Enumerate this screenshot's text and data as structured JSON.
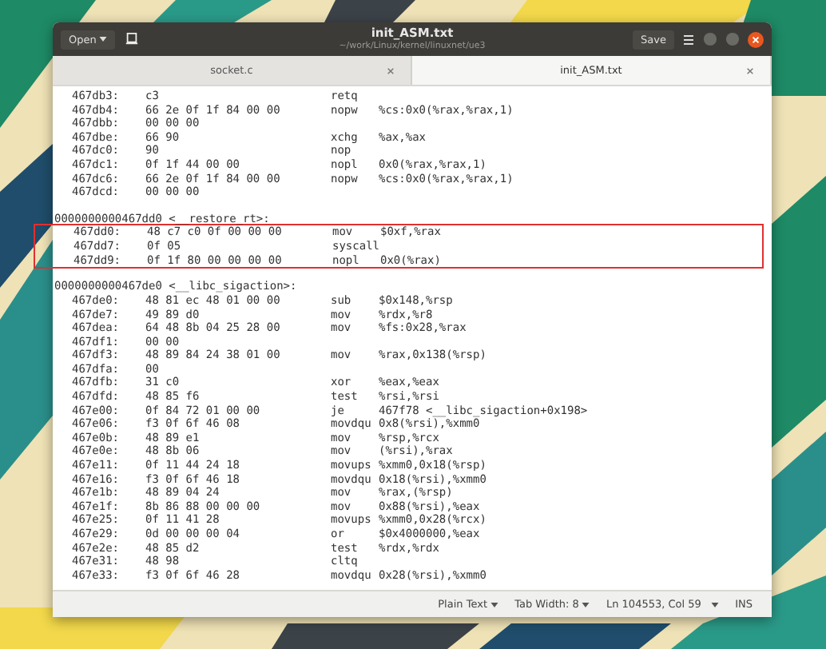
{
  "window": {
    "title": "init_ASM.txt",
    "subtitle": "~/work/Linux/kernel/linuxnet/ue3"
  },
  "header": {
    "open_button": "Open",
    "save_button": "Save"
  },
  "tabs": [
    {
      "label": "socket.c",
      "selected": false
    },
    {
      "label": "init_ASM.txt",
      "selected": true
    }
  ],
  "lines": [
    {
      "kind": "instr",
      "addr": "467db3:",
      "bytes": "c3",
      "mnemonic": "retq",
      "highlighted": false
    },
    {
      "kind": "instr",
      "addr": "467db4:",
      "bytes": "66 2e 0f 1f 84 00 00",
      "mnemonic": "nopw",
      "operands": "%cs:0x0(%rax,%rax,1)",
      "highlighted": false
    },
    {
      "kind": "instr",
      "addr": "467dbb:",
      "bytes": "00 00 00",
      "highlighted": false
    },
    {
      "kind": "instr",
      "addr": "467dbe:",
      "bytes": "66 90",
      "mnemonic": "xchg",
      "operands": "%ax,%ax",
      "highlighted": false
    },
    {
      "kind": "instr",
      "addr": "467dc0:",
      "bytes": "90",
      "mnemonic": "nop",
      "highlighted": false
    },
    {
      "kind": "instr",
      "addr": "467dc1:",
      "bytes": "0f 1f 44 00 00",
      "mnemonic": "nopl",
      "operands": "0x0(%rax,%rax,1)",
      "highlighted": false
    },
    {
      "kind": "instr",
      "addr": "467dc6:",
      "bytes": "66 2e 0f 1f 84 00 00",
      "mnemonic": "nopw",
      "operands": "%cs:0x0(%rax,%rax,1)",
      "highlighted": false
    },
    {
      "kind": "instr",
      "addr": "467dcd:",
      "bytes": "00 00 00",
      "highlighted": false
    },
    {
      "kind": "blank"
    },
    {
      "kind": "label",
      "text": "0000000000467dd0 <__restore_rt>:",
      "highlighted": false
    },
    {
      "kind": "instr",
      "addr": "467dd0:",
      "bytes": "48 c7 c0 0f 00 00 00",
      "mnemonic": "mov",
      "operands": "$0xf,%rax",
      "highlighted": true
    },
    {
      "kind": "instr",
      "addr": "467dd7:",
      "bytes": "0f 05",
      "mnemonic": "syscall",
      "highlighted": true
    },
    {
      "kind": "instr",
      "addr": "467dd9:",
      "bytes": "0f 1f 80 00 00 00 00",
      "mnemonic": "nopl",
      "operands": "0x0(%rax)",
      "highlighted": true
    },
    {
      "kind": "blank"
    },
    {
      "kind": "label",
      "text": "0000000000467de0 <__libc_sigaction>:",
      "highlighted": false
    },
    {
      "kind": "instr",
      "addr": "467de0:",
      "bytes": "48 81 ec 48 01 00 00",
      "mnemonic": "sub",
      "operands": "$0x148,%rsp",
      "highlighted": false
    },
    {
      "kind": "instr",
      "addr": "467de7:",
      "bytes": "49 89 d0",
      "mnemonic": "mov",
      "operands": "%rdx,%r8",
      "highlighted": false
    },
    {
      "kind": "instr",
      "addr": "467dea:",
      "bytes": "64 48 8b 04 25 28 00",
      "mnemonic": "mov",
      "operands": "%fs:0x28,%rax",
      "highlighted": false
    },
    {
      "kind": "instr",
      "addr": "467df1:",
      "bytes": "00 00",
      "highlighted": false
    },
    {
      "kind": "instr",
      "addr": "467df3:",
      "bytes": "48 89 84 24 38 01 00",
      "mnemonic": "mov",
      "operands": "%rax,0x138(%rsp)",
      "highlighted": false
    },
    {
      "kind": "instr",
      "addr": "467dfa:",
      "bytes": "00",
      "highlighted": false
    },
    {
      "kind": "instr",
      "addr": "467dfb:",
      "bytes": "31 c0",
      "mnemonic": "xor",
      "operands": "%eax,%eax",
      "highlighted": false
    },
    {
      "kind": "instr",
      "addr": "467dfd:",
      "bytes": "48 85 f6",
      "mnemonic": "test",
      "operands": "%rsi,%rsi",
      "highlighted": false
    },
    {
      "kind": "instr",
      "addr": "467e00:",
      "bytes": "0f 84 72 01 00 00",
      "mnemonic": "je",
      "operands": "467f78 <__libc_sigaction+0x198>",
      "highlighted": false
    },
    {
      "kind": "instr",
      "addr": "467e06:",
      "bytes": "f3 0f 6f 46 08",
      "mnemonic": "movdqu",
      "operands": "0x8(%rsi),%xmm0",
      "highlighted": false
    },
    {
      "kind": "instr",
      "addr": "467e0b:",
      "bytes": "48 89 e1",
      "mnemonic": "mov",
      "operands": "%rsp,%rcx",
      "highlighted": false
    },
    {
      "kind": "instr",
      "addr": "467e0e:",
      "bytes": "48 8b 06",
      "mnemonic": "mov",
      "operands": "(%rsi),%rax",
      "highlighted": false
    },
    {
      "kind": "instr",
      "addr": "467e11:",
      "bytes": "0f 11 44 24 18",
      "mnemonic": "movups",
      "operands": "%xmm0,0x18(%rsp)",
      "highlighted": false
    },
    {
      "kind": "instr",
      "addr": "467e16:",
      "bytes": "f3 0f 6f 46 18",
      "mnemonic": "movdqu",
      "operands": "0x18(%rsi),%xmm0",
      "highlighted": false
    },
    {
      "kind": "instr",
      "addr": "467e1b:",
      "bytes": "48 89 04 24",
      "mnemonic": "mov",
      "operands": "%rax,(%rsp)",
      "highlighted": false
    },
    {
      "kind": "instr",
      "addr": "467e1f:",
      "bytes": "8b 86 88 00 00 00",
      "mnemonic": "mov",
      "operands": "0x88(%rsi),%eax",
      "highlighted": false
    },
    {
      "kind": "instr",
      "addr": "467e25:",
      "bytes": "0f 11 41 28",
      "mnemonic": "movups",
      "operands": "%xmm0,0x28(%rcx)",
      "highlighted": false
    },
    {
      "kind": "instr",
      "addr": "467e29:",
      "bytes": "0d 00 00 00 04",
      "mnemonic": "or",
      "operands": "$0x4000000,%eax",
      "highlighted": false
    },
    {
      "kind": "instr",
      "addr": "467e2e:",
      "bytes": "48 85 d2",
      "mnemonic": "test",
      "operands": "%rdx,%rdx",
      "highlighted": false
    },
    {
      "kind": "instr",
      "addr": "467e31:",
      "bytes": "48 98",
      "mnemonic": "cltq",
      "highlighted": false
    },
    {
      "kind": "instr",
      "addr": "467e33:",
      "bytes": "f3 0f 6f 46 28",
      "mnemonic": "movdqu",
      "operands": "0x28(%rsi),%xmm0",
      "highlighted": false
    }
  ],
  "status_bar": {
    "language": "Plain Text",
    "tab_width": "Tab Width: 8",
    "position": "Ln 104553, Col 59",
    "mode": "INS"
  }
}
